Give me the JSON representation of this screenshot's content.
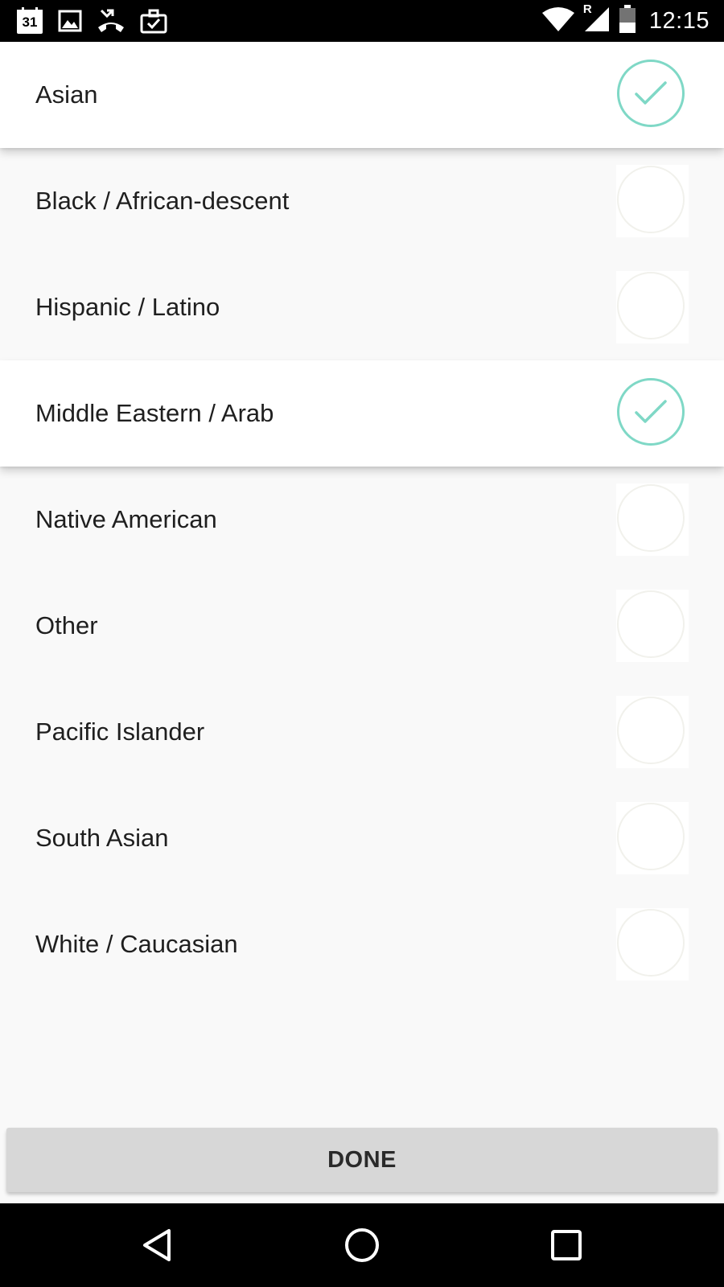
{
  "status_bar": {
    "calendar_day": "31",
    "time": "12:15",
    "roaming_indicator": "R",
    "icons": [
      "calendar-icon",
      "gallery-icon",
      "missed-call-icon",
      "briefcase-icon",
      "wifi-icon",
      "signal-icon",
      "battery-icon"
    ]
  },
  "options": [
    {
      "label": "Asian",
      "selected": true
    },
    {
      "label": "Black / African-descent",
      "selected": false
    },
    {
      "label": "Hispanic / Latino",
      "selected": false
    },
    {
      "label": "Middle Eastern / Arab",
      "selected": true
    },
    {
      "label": "Native American",
      "selected": false
    },
    {
      "label": "Other",
      "selected": false
    },
    {
      "label": "Pacific Islander",
      "selected": false
    },
    {
      "label": "South Asian",
      "selected": false
    },
    {
      "label": "White / Caucasian",
      "selected": false
    }
  ],
  "done_button": {
    "label": "DONE"
  },
  "nav_bar": {
    "icons": [
      "back-icon",
      "home-icon",
      "recents-icon"
    ]
  },
  "colors": {
    "accent_check": "#7fd8c6",
    "selected_row_bg": "#ffffff",
    "list_bg": "#f9f9f9",
    "button_bg": "#d7d7d7"
  }
}
